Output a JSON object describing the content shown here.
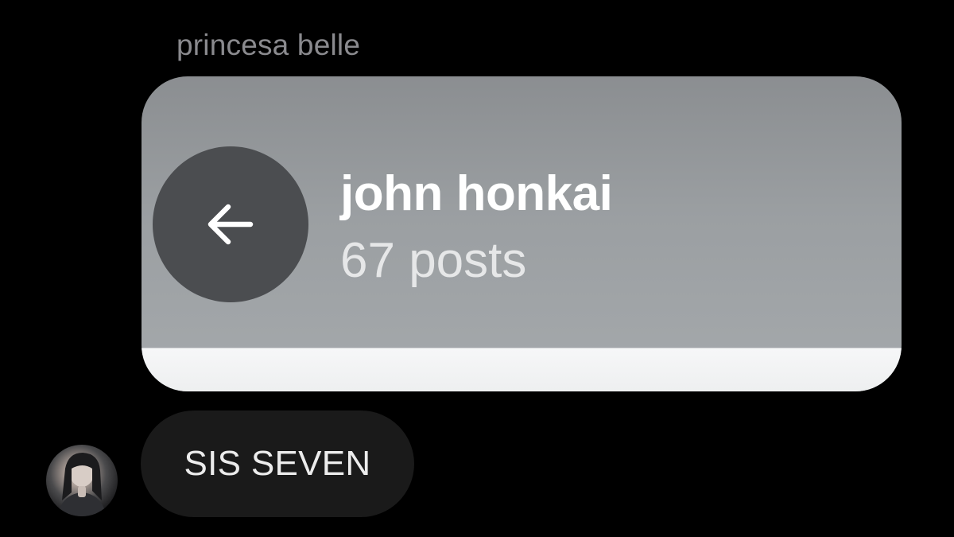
{
  "message_group": {
    "sender_name": "princesa belle"
  },
  "shared_profile_card": {
    "back_icon": "arrow-left-icon",
    "display_name": "john honkai",
    "post_count": "67",
    "post_count_unit": "posts"
  },
  "message": {
    "avatar_icon": "user-avatar",
    "text": "SIS SEVEN"
  },
  "colors": {
    "background": "#000000",
    "card_top": "#8b8e91",
    "card_bottom": "#a5a9ac",
    "back_button": "#4b4d50",
    "bubble": "#1a1a1a",
    "sender_name": "#8a8a8e"
  }
}
